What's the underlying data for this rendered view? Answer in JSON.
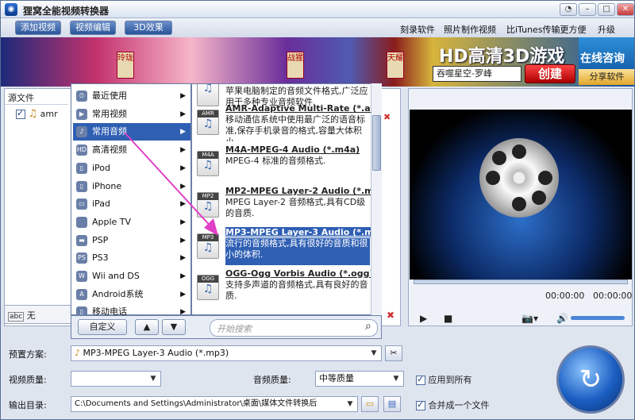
{
  "title": "狸窝全能视频转换器",
  "window": {
    "skin": "◔",
    "minimize": "–",
    "maximize": "□",
    "close": "✕"
  },
  "toolbar": {
    "add_video": "添加视频",
    "edit_video": "视频编辑",
    "effect_3d": "3D效果",
    "burn": "刻录软件",
    "photo": "照片制作视频",
    "itunes": "比iTunes传输更方便",
    "upgrade": "升级"
  },
  "banner": {
    "hd_title": "HD高清3D游戏",
    "game_name": "吞噬星空-罗峰",
    "create": "创建",
    "consult": "在线咨询",
    "share": "分享软件",
    "tags": [
      "玲珑",
      "战猩",
      "天耀"
    ]
  },
  "source": {
    "header": "源文件",
    "file": "amr",
    "subtitle": "无"
  },
  "category_menu": [
    {
      "icon": "⏱",
      "label": "最近使用"
    },
    {
      "icon": "▶",
      "label": "常用视频"
    },
    {
      "icon": "♪",
      "label": "常用音频",
      "selected": true
    },
    {
      "icon": "HD",
      "label": "高清视频"
    },
    {
      "icon": "▯",
      "label": "iPod"
    },
    {
      "icon": "▯",
      "label": "iPhone"
    },
    {
      "icon": "▭",
      "label": "iPad"
    },
    {
      "icon": "",
      "label": "Apple TV"
    },
    {
      "icon": "▬",
      "label": "PSP"
    },
    {
      "icon": "PS",
      "label": "PS3"
    },
    {
      "icon": "W",
      "label": "Wii and DS"
    },
    {
      "icon": "A",
      "label": "Android系统"
    },
    {
      "icon": "▯",
      "label": "移动电话"
    }
  ],
  "formats": [
    {
      "tag": "",
      "title": "",
      "desc": "苹果电脑制定的音频文件格式,广泛应用于多种专业音频软件."
    },
    {
      "tag": "AMR",
      "title": "AMR-Adaptive Multi-Rate (*.amr)",
      "desc": "移动通信系统中使用最广泛的语音标准,保存手机录音的格式,容量大体积小."
    },
    {
      "tag": "M4A",
      "title": "M4A-MPEG-4 Audio (*.m4a)",
      "desc": "MPEG-4 标准的音频格式."
    },
    {
      "tag": "MP2",
      "title": "MP2-MPEG Layer-2 Audio (*.mp2)",
      "desc": "MPEG Layer-2 音频格式,具有CD级的音质."
    },
    {
      "tag": "MP3",
      "title": "MP3-MPEG Layer-3 Audio (*.mp3)",
      "desc": "流行的音频格式,具有很好的音质和很小的体积.",
      "selected": true
    },
    {
      "tag": "OGG",
      "title": "OGG-Ogg Vorbis Audio (*.ogg)",
      "desc": "支持多声道的音频格式,具有良好的音质."
    }
  ],
  "menu_bottom": {
    "custom": "自定义",
    "search_placeholder": "开始搜索"
  },
  "preview": {
    "time_left": "00:00:00",
    "time_right": "00:00:00"
  },
  "bottom": {
    "preset_label": "预置方案:",
    "preset_value": "MP3-MPEG Layer-3 Audio (*.mp3)",
    "video_quality_label": "视频质量:",
    "video_quality_value": "",
    "audio_quality_label": "音频质量:",
    "audio_quality_value": "中等质量",
    "apply_all": "应用到所有",
    "output_label": "输出目录:",
    "output_value": "C:\\Documents and Settings\\Administrator\\桌面\\媒体文件转换后",
    "merge": "合并成一个文件"
  }
}
